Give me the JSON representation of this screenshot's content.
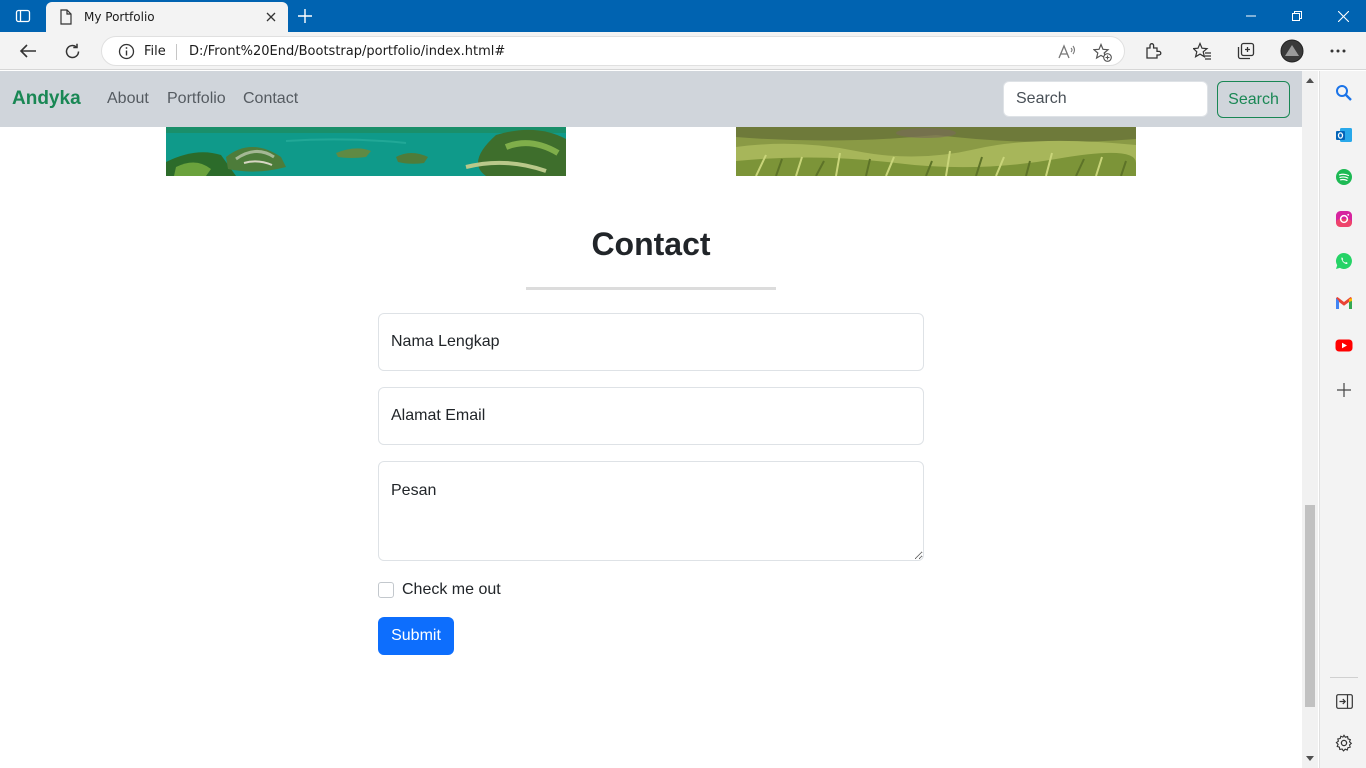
{
  "browser": {
    "tab_title": "My Portfolio",
    "address_prefix": "File",
    "url": "D:/Front%20End/Bootstrap/portfolio/index.html#",
    "icons": [
      "tab-actions-icon",
      "page-icon",
      "close-icon",
      "new-tab-icon",
      "back-icon",
      "refresh-icon",
      "info-icon",
      "read-aloud-icon",
      "favorite-add-icon",
      "extensions-icon",
      "favorites-icon",
      "collections-icon",
      "profile-icon",
      "more-icon",
      "minimize-icon",
      "restore-icon",
      "window-close-icon"
    ],
    "accent_color": "#0063b1"
  },
  "sidebar": {
    "icons": [
      "search-icon",
      "outlook-icon",
      "spotify-icon",
      "instagram-icon",
      "whatsapp-icon",
      "gmail-icon",
      "youtube-icon",
      "add-icon",
      "hide-sidebar-icon",
      "settings-icon"
    ]
  },
  "site": {
    "brand": "Andyka",
    "nav": [
      "About",
      "Portfolio",
      "Contact"
    ],
    "search_placeholder": "Search",
    "search_button": "Search",
    "brand_color": "#198754"
  },
  "contact": {
    "title": "Contact",
    "name_placeholder": "Nama Lengkap",
    "email_placeholder": "Alamat Email",
    "message_placeholder": "Pesan",
    "checkbox_label": "Check me out",
    "submit_label": "Submit",
    "submit_color": "#0d6efd"
  }
}
